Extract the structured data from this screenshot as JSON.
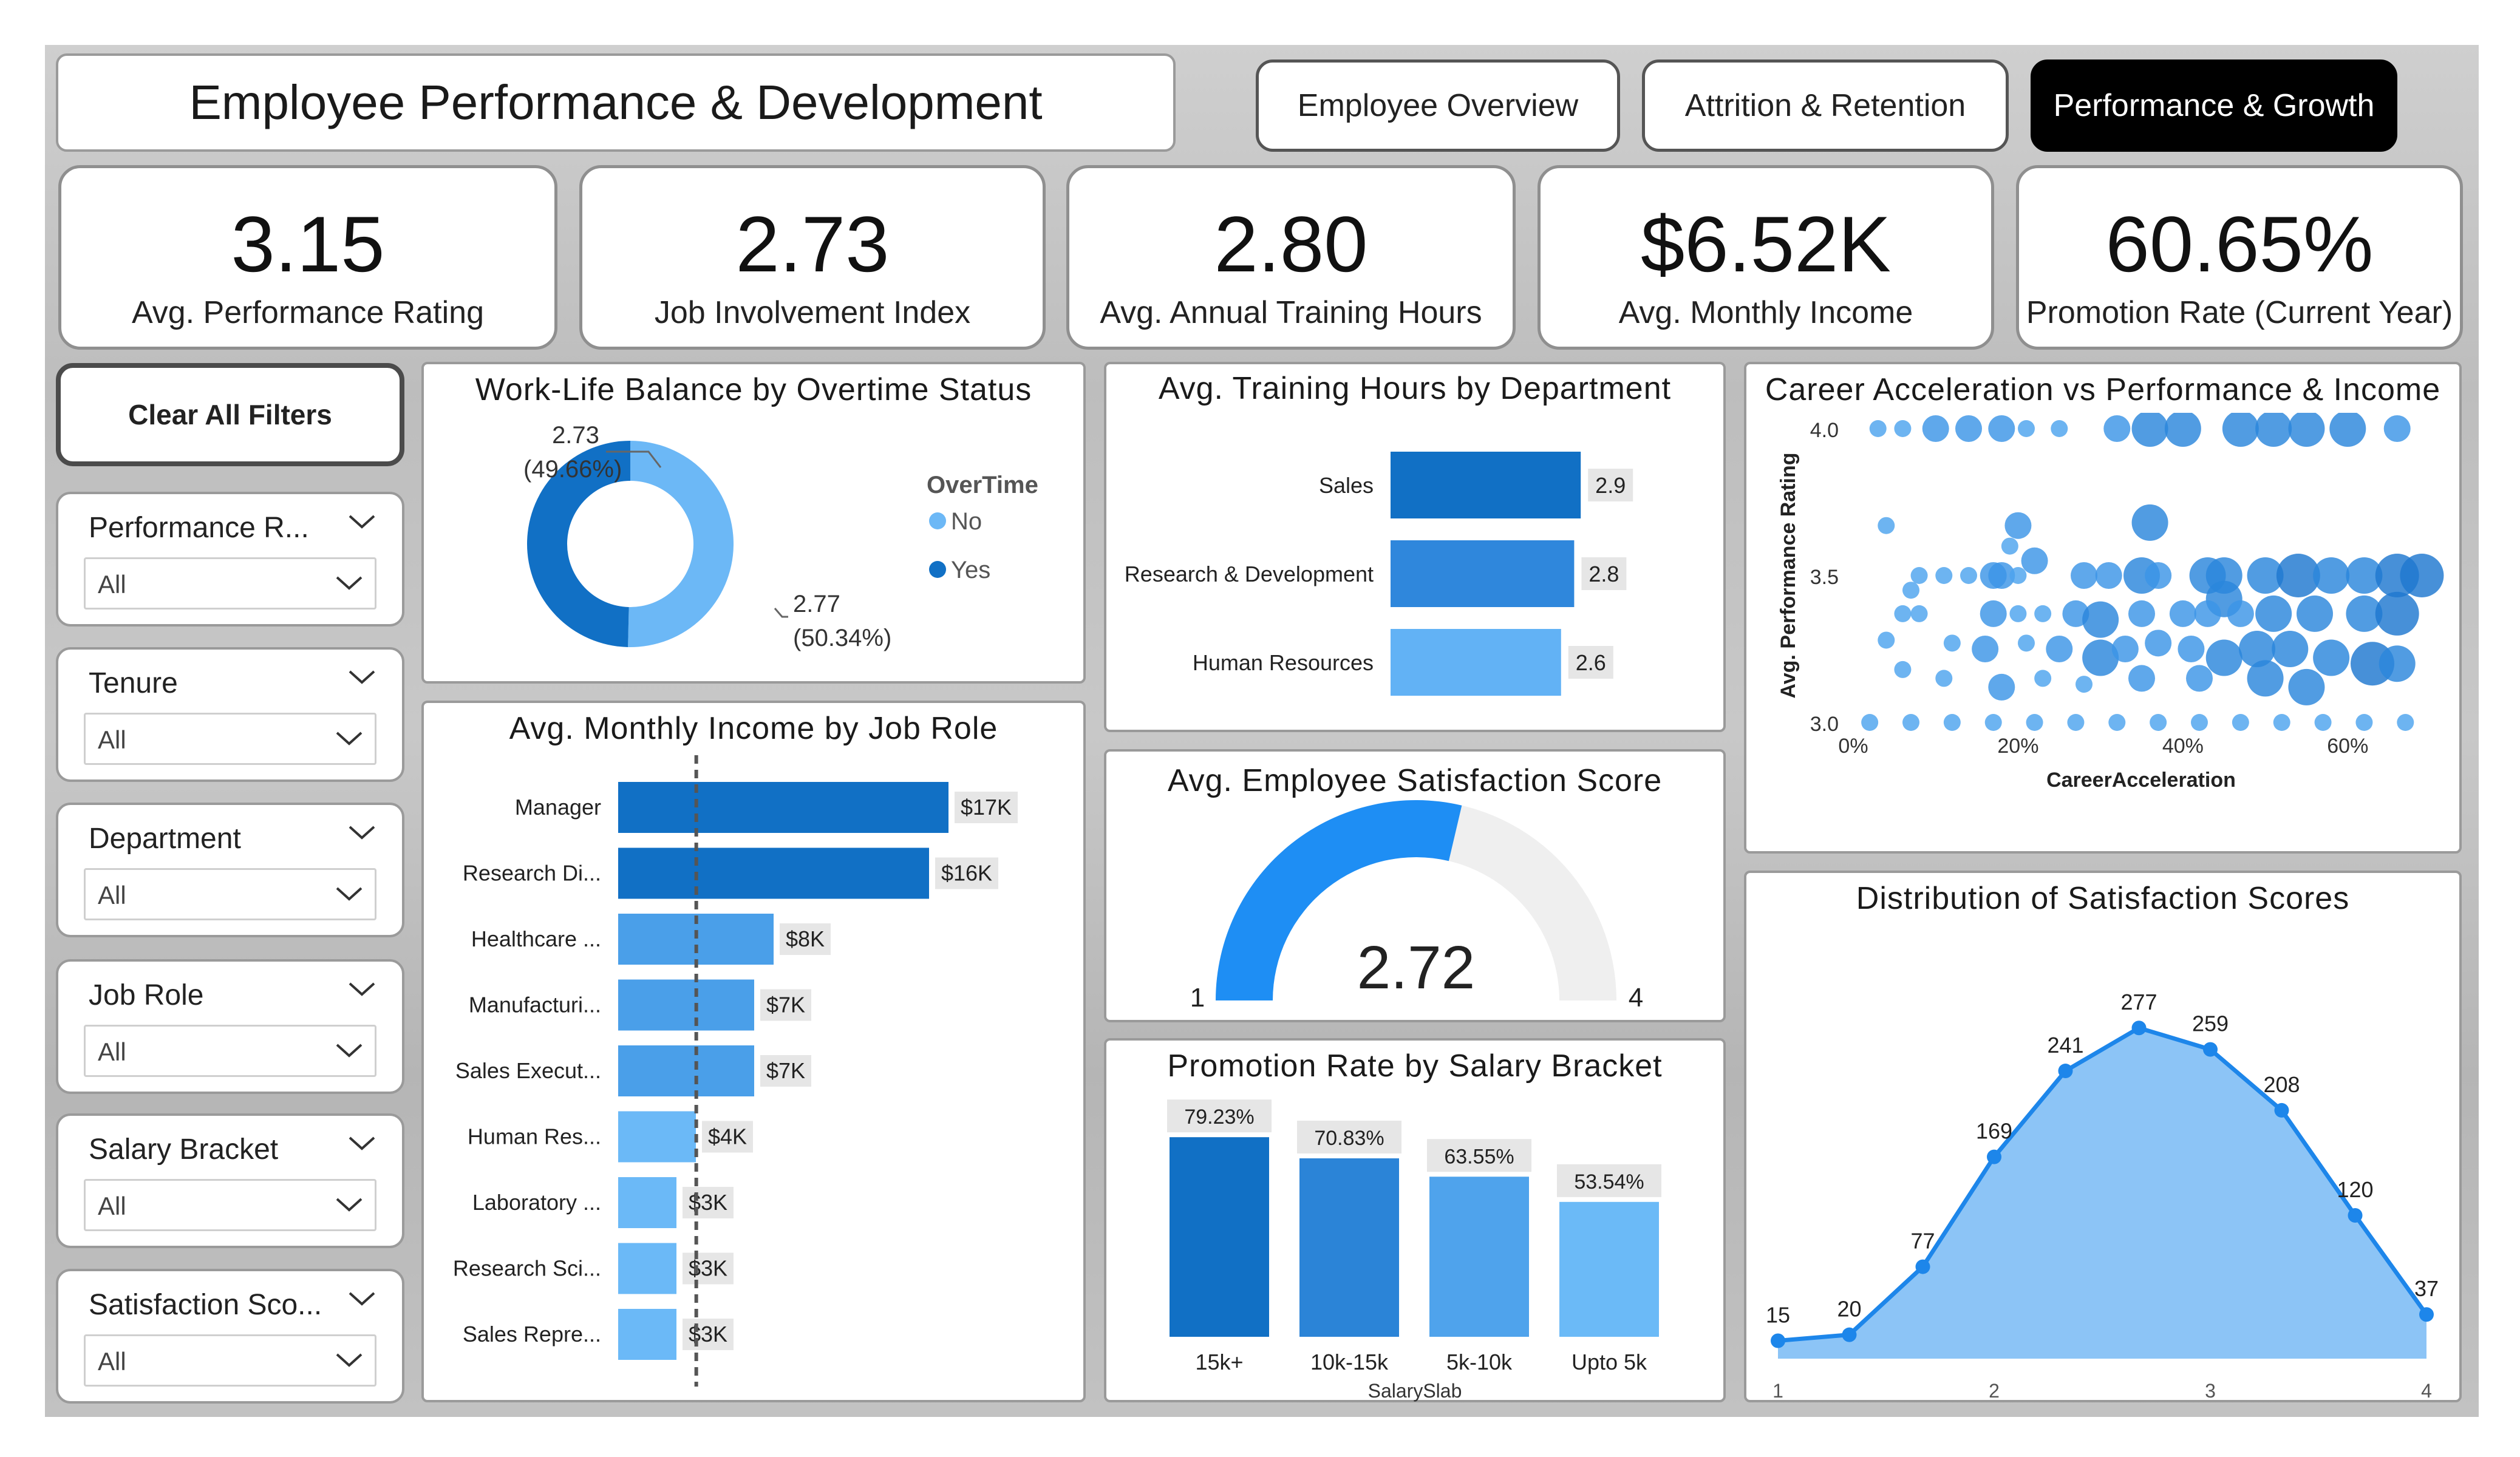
{
  "header": {
    "title": "Employee Performance & Development"
  },
  "nav": {
    "tabs": [
      "Employee Overview",
      "Attrition & Retention",
      "Performance & Growth"
    ],
    "active": 2
  },
  "kpis": [
    {
      "value": "3.15",
      "label": "Avg. Performance Rating"
    },
    {
      "value": "2.73",
      "label": "Job Involvement Index"
    },
    {
      "value": "2.80",
      "label": "Avg. Annual Training Hours"
    },
    {
      "value": "$6.52K",
      "label": "Avg. Monthly Income"
    },
    {
      "value": "60.65%",
      "label": "Promotion Rate (Current Year)"
    }
  ],
  "filters": {
    "clear_label": "Clear All Filters",
    "slicers": [
      {
        "title": "Performance R...",
        "value": "All"
      },
      {
        "title": "Tenure",
        "value": "All"
      },
      {
        "title": "Department",
        "value": "All"
      },
      {
        "title": "Job Role",
        "value": "All"
      },
      {
        "title": "Salary Bracket",
        "value": "All"
      },
      {
        "title": "Satisfaction Sco...",
        "value": "All"
      }
    ]
  },
  "worklife": {
    "title": "Work-Life Balance by Overtime Status",
    "legend_title": "OverTime",
    "colors": {
      "No": "#6cb8f6",
      "Yes": "#1170c5"
    },
    "chart_data": {
      "type": "pie",
      "categories": [
        "No",
        "Yes"
      ],
      "values": [
        2.77,
        2.73
      ],
      "percents": [
        "50.34%",
        "49.66%"
      ],
      "value_labels": [
        "2.77",
        "2.73"
      ]
    }
  },
  "training": {
    "title": "Avg. Training Hours by Department",
    "chart_data": {
      "type": "bar",
      "categories": [
        "Sales",
        "Research & Development",
        "Human Resources"
      ],
      "values": [
        2.9,
        2.8,
        2.6
      ],
      "labels": [
        "2.9",
        "2.8",
        "2.6"
      ],
      "colors": [
        "#1170c5",
        "#2f87dc",
        "#62b2f5"
      ]
    }
  },
  "career": {
    "title": "Career Acceleration vs Performance & Income",
    "xlabel": "CareerAcceleration",
    "ylabel": "Avg. Performance Rating",
    "chart_data": {
      "type": "scatter",
      "x_ticks": [
        "0%",
        "20%",
        "40%",
        "60%"
      ],
      "y_ticks": [
        "3.0",
        "3.5",
        "4.0"
      ],
      "xlim": [
        0,
        0.7
      ],
      "ylim": [
        3.0,
        4.0
      ],
      "points": [
        [
          0.03,
          4.0,
          1
        ],
        [
          0.06,
          4.0,
          1
        ],
        [
          0.1,
          4.0,
          2
        ],
        [
          0.14,
          4.0,
          2
        ],
        [
          0.18,
          4.0,
          2
        ],
        [
          0.21,
          4.0,
          1
        ],
        [
          0.25,
          4.0,
          1
        ],
        [
          0.32,
          4.0,
          2
        ],
        [
          0.36,
          4.0,
          3
        ],
        [
          0.4,
          4.0,
          3
        ],
        [
          0.47,
          4.0,
          3
        ],
        [
          0.51,
          4.0,
          3
        ],
        [
          0.55,
          4.0,
          3
        ],
        [
          0.6,
          4.0,
          3
        ],
        [
          0.66,
          4.0,
          2
        ],
        [
          0.04,
          3.67,
          1
        ],
        [
          0.2,
          3.67,
          2
        ],
        [
          0.36,
          3.68,
          3
        ],
        [
          0.19,
          3.6,
          1
        ],
        [
          0.08,
          3.5,
          1
        ],
        [
          0.11,
          3.5,
          1
        ],
        [
          0.14,
          3.5,
          1
        ],
        [
          0.17,
          3.5,
          2
        ],
        [
          0.18,
          3.5,
          2
        ],
        [
          0.2,
          3.5,
          1
        ],
        [
          0.22,
          3.55,
          2
        ],
        [
          0.28,
          3.5,
          2
        ],
        [
          0.31,
          3.5,
          2
        ],
        [
          0.35,
          3.5,
          3
        ],
        [
          0.37,
          3.5,
          2
        ],
        [
          0.43,
          3.5,
          3
        ],
        [
          0.45,
          3.5,
          3
        ],
        [
          0.5,
          3.5,
          3
        ],
        [
          0.54,
          3.5,
          4
        ],
        [
          0.58,
          3.5,
          3
        ],
        [
          0.62,
          3.5,
          3
        ],
        [
          0.66,
          3.5,
          4
        ],
        [
          0.69,
          3.5,
          4
        ],
        [
          0.07,
          3.45,
          1
        ],
        [
          0.45,
          3.42,
          3
        ],
        [
          0.06,
          3.37,
          1
        ],
        [
          0.08,
          3.37,
          1
        ],
        [
          0.17,
          3.37,
          2
        ],
        [
          0.2,
          3.37,
          1
        ],
        [
          0.23,
          3.37,
          1
        ],
        [
          0.27,
          3.37,
          2
        ],
        [
          0.3,
          3.35,
          3
        ],
        [
          0.35,
          3.37,
          2
        ],
        [
          0.4,
          3.37,
          2
        ],
        [
          0.43,
          3.37,
          2
        ],
        [
          0.47,
          3.37,
          2
        ],
        [
          0.51,
          3.37,
          3
        ],
        [
          0.56,
          3.37,
          3
        ],
        [
          0.62,
          3.37,
          3
        ],
        [
          0.66,
          3.37,
          4
        ],
        [
          0.04,
          3.28,
          1
        ],
        [
          0.12,
          3.27,
          1
        ],
        [
          0.16,
          3.25,
          2
        ],
        [
          0.21,
          3.27,
          1
        ],
        [
          0.25,
          3.25,
          2
        ],
        [
          0.3,
          3.22,
          3
        ],
        [
          0.33,
          3.25,
          2
        ],
        [
          0.37,
          3.27,
          2
        ],
        [
          0.41,
          3.25,
          2
        ],
        [
          0.45,
          3.22,
          3
        ],
        [
          0.49,
          3.25,
          3
        ],
        [
          0.53,
          3.25,
          3
        ],
        [
          0.58,
          3.22,
          3
        ],
        [
          0.63,
          3.2,
          4
        ],
        [
          0.66,
          3.2,
          3
        ],
        [
          0.06,
          3.18,
          1
        ],
        [
          0.11,
          3.15,
          1
        ],
        [
          0.18,
          3.12,
          2
        ],
        [
          0.23,
          3.15,
          1
        ],
        [
          0.28,
          3.13,
          1
        ],
        [
          0.35,
          3.15,
          2
        ],
        [
          0.42,
          3.15,
          2
        ],
        [
          0.5,
          3.15,
          3
        ],
        [
          0.55,
          3.12,
          3
        ],
        [
          0.02,
          3.0,
          1
        ],
        [
          0.07,
          3.0,
          1
        ],
        [
          0.12,
          3.0,
          1
        ],
        [
          0.17,
          3.0,
          1
        ],
        [
          0.22,
          3.0,
          1
        ],
        [
          0.27,
          3.0,
          1
        ],
        [
          0.32,
          3.0,
          1
        ],
        [
          0.37,
          3.0,
          1
        ],
        [
          0.42,
          3.0,
          1
        ],
        [
          0.47,
          3.0,
          1
        ],
        [
          0.52,
          3.0,
          1
        ],
        [
          0.57,
          3.0,
          1
        ],
        [
          0.62,
          3.0,
          1
        ],
        [
          0.67,
          3.0,
          1
        ]
      ]
    }
  },
  "income": {
    "title": "Avg. Monthly Income by Job Role",
    "chart_data": {
      "type": "bar",
      "categories": [
        "Manager",
        "Research Di...",
        "Healthcare ...",
        "Manufacturi...",
        "Sales Execut...",
        "Human Res...",
        "Laboratory ...",
        "Research Sci...",
        "Sales Repre..."
      ],
      "values": [
        17,
        16,
        8,
        7,
        7,
        4,
        3,
        3,
        3
      ],
      "labels": [
        "$17K",
        "$16K",
        "$8K",
        "$7K",
        "$7K",
        "$4K",
        "$3K",
        "$3K",
        "$3K"
      ],
      "average": 6.52,
      "colors": [
        "#1170c5",
        "#1170c5",
        "#4a9fe9",
        "#4a9fe9",
        "#4a9fe9",
        "#6bb9f7",
        "#6bb9f7",
        "#6bb9f7",
        "#6bb9f7"
      ]
    }
  },
  "satisfaction": {
    "title": "Avg. Employee Satisfaction Score",
    "chart_data": {
      "type": "gauge",
      "value": 2.72,
      "min": 1,
      "max": 4
    },
    "value_label": "2.72",
    "min_label": "1",
    "max_label": "4"
  },
  "promotion": {
    "title": "Promotion Rate by Salary Bracket",
    "xlabel": "SalarySlab",
    "chart_data": {
      "type": "bar",
      "categories": [
        "15k+",
        "10k-15k",
        "5k-10k",
        "Upto 5k"
      ],
      "values": [
        79.23,
        70.83,
        63.55,
        53.54
      ],
      "labels": [
        "79.23%",
        "70.83%",
        "63.55%",
        "53.54%"
      ],
      "colors": [
        "#1170c5",
        "#2b84d7",
        "#4fa3ec",
        "#6bbaf7"
      ]
    }
  },
  "distribution": {
    "title": "Distribution of Satisfaction Scores",
    "chart_data": {
      "type": "area",
      "x": [
        1,
        1.33,
        1.67,
        2,
        2.33,
        2.67,
        3,
        3.33,
        3.67,
        4
      ],
      "values": [
        15,
        20,
        77,
        169,
        241,
        277,
        259,
        208,
        120,
        37
      ],
      "x_ticks": [
        "1",
        "2",
        "3",
        "4"
      ],
      "ylim": [
        0,
        300
      ]
    }
  }
}
